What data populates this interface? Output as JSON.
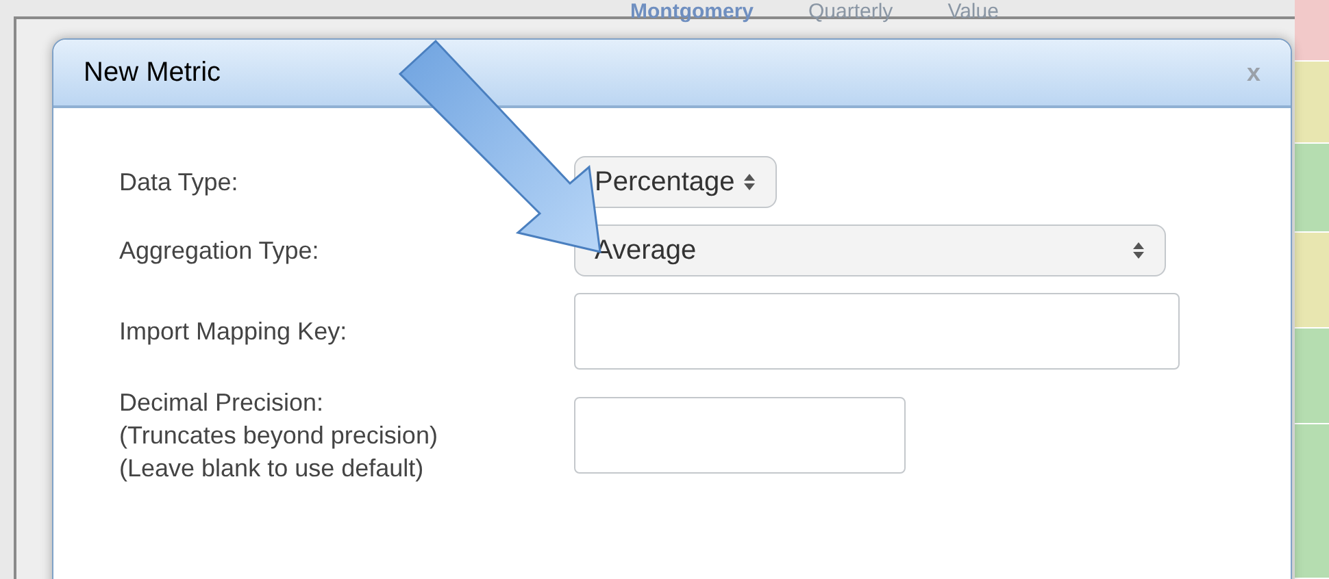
{
  "background": {
    "headers": [
      "Montgomery",
      "Quarterly",
      "Value"
    ],
    "status_cells": [
      {
        "color": "#f2c9c9"
      },
      {
        "color": "#e8e6b0"
      },
      {
        "color": "#b5ddb0"
      },
      {
        "color": "#e8e6b0"
      },
      {
        "color": "#b5ddb0"
      },
      {
        "color": "#b5ddb0"
      }
    ]
  },
  "dialog": {
    "title": "New Metric",
    "close": "x",
    "fields": [
      {
        "kind": "select",
        "label": "Data Type:",
        "value": "Percentage"
      },
      {
        "kind": "select",
        "label": "Aggregation Type:",
        "value": "Average"
      },
      {
        "kind": "input",
        "label": "Import Mapping Key:"
      },
      {
        "kind": "input",
        "label": "Decimal Precision:\n(Truncates beyond precision)\n(Leave blank to use default)"
      }
    ]
  }
}
